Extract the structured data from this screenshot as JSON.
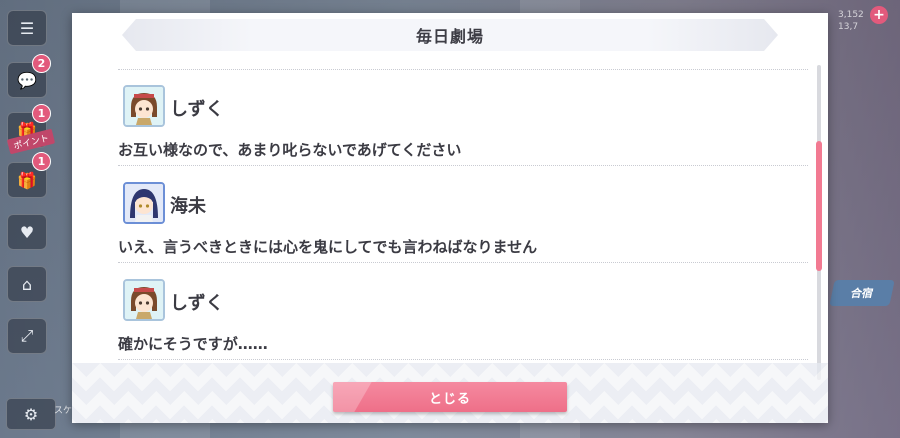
{
  "dialog": {
    "title": "毎日劇場",
    "close_label": "とじる",
    "scroll_position": 0.35
  },
  "entries": [
    {
      "speaker": "しずく",
      "avatar_icon": "shizuku-avatar-icon",
      "line": "お互い様なので、あまり叱らないであげてください"
    },
    {
      "speaker": "海未",
      "avatar_icon": "umi-avatar-icon",
      "line": "いえ、言うべきときには心を鬼にしてでも言わねばなりません"
    },
    {
      "speaker": "しずく",
      "avatar_icon": "shizuku-avatar-icon",
      "line": "確かにそうですが……"
    }
  ],
  "left_rail": {
    "badges": [
      "2",
      "1",
      "1"
    ],
    "ribbon_text": "ポイント"
  },
  "right_panel": {
    "stats": [
      "3,152",
      "13,7"
    ],
    "ticket_label": "合宿"
  },
  "bottom_left": {
    "label": "スケ アイ"
  },
  "colors": {
    "accent_pink": "#ee6f88",
    "title_text": "#3d3d45",
    "body_text": "#3b3b43",
    "badge": "#e25a7c"
  }
}
